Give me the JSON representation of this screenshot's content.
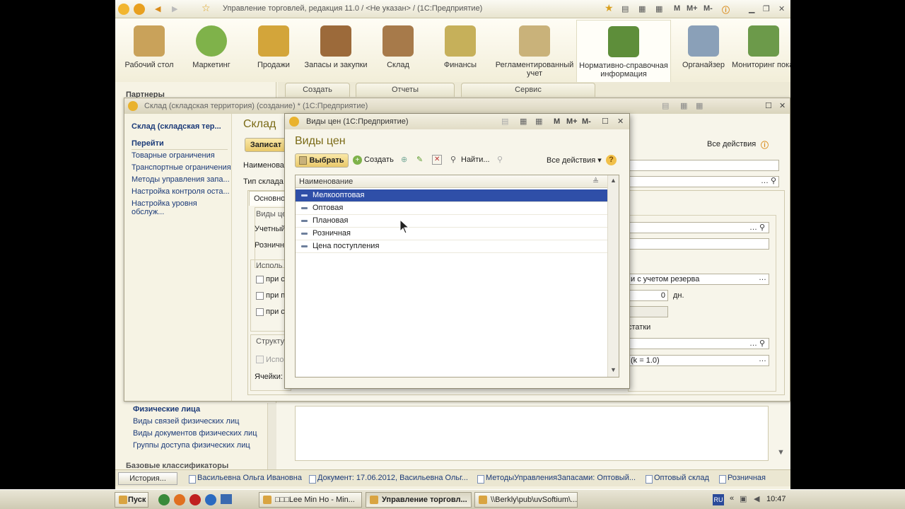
{
  "app": {
    "title": "Управление торговлей, редакция 11.0 / <Не указан> / (1С:Предприятие)",
    "title_buttons": [
      "M",
      "M+",
      "M-"
    ]
  },
  "sections": [
    {
      "label": "Рабочий стол",
      "icon": "desk-icon",
      "color": "#c9a25a"
    },
    {
      "label": "Маркетинг",
      "icon": "pie-chart-icon",
      "color": "#7fb24a"
    },
    {
      "label": "Продажи",
      "icon": "truck-icon",
      "color": "#d3a53a"
    },
    {
      "label": "Запасы и закупки",
      "icon": "boxes-icon",
      "color": "#9c6a3a"
    },
    {
      "label": "Склад",
      "icon": "warehouse-icon",
      "color": "#a77a4a"
    },
    {
      "label": "Финансы",
      "icon": "coins-icon",
      "color": "#c6b05a"
    },
    {
      "label": "Регламентированный учет",
      "icon": "ledger-icon",
      "color": "#c9b27a"
    },
    {
      "label": "Нормативно-справочная информация",
      "icon": "binders-icon",
      "color": "#5e8e3a"
    },
    {
      "label": "Органайзер",
      "icon": "clipboard-icon",
      "color": "#8aa0b8"
    },
    {
      "label": "Мониторинг показ",
      "icon": "monitor-icon",
      "color": "#6c9a4a"
    }
  ],
  "section_tabs": [
    "Создать",
    "Отчеты",
    "Сервис"
  ],
  "left_panel": {
    "top_header": "Партнеры",
    "header": "Физические лица",
    "items": [
      "Виды связей физических лиц",
      "Виды документов физических лиц",
      "Группы доступа физических лиц"
    ],
    "bottom_header": "Базовые классификаторы"
  },
  "sklad": {
    "title": "Склад (складская территория) (создание) * (1С:Предприятие)",
    "nav_title": "Склад (складская тер...",
    "nav_header": "Перейти",
    "nav_items": [
      "Товарные ограничения",
      "Транспортные ограничения",
      "Методы управления запа...",
      "Настройка контроля оста...",
      "Настройка уровня обслуж..."
    ],
    "heading": "Склад",
    "save_label": "Записат",
    "all_actions": "Все действия",
    "labels": {
      "name": "Наименова",
      "type": "Тип склада",
      "tab_main": "Основно",
      "group_prices": "Виды це",
      "accounting": "Учетный",
      "retail": "Розничн",
      "usage": "Исполь",
      "check1": "при с",
      "check2": "при п",
      "check3": "при с",
      "structure": "Структу",
      "use": "Испо",
      "cells": "Ячейки:",
      "reserve": "и с учетом резерва",
      "days_value": "0",
      "days": "дн.",
      "remains": "статки",
      "coef": "(k = 1.0)"
    }
  },
  "dialog": {
    "title": "Виды цен (1С:Предприятие)",
    "heading": "Виды цен",
    "toolbar": {
      "select": "Выбрать",
      "create": "Создать",
      "find": "Найти...",
      "all_actions": "Все действия"
    },
    "column": "Наименование",
    "rows": [
      "Мелкооптовая",
      "Оптовая",
      "Плановая",
      "Розничная",
      "Цена поступления"
    ],
    "selected_index": 0
  },
  "status_bar": {
    "history": "История...",
    "items": [
      "Васильевна Ольга Ивановна",
      "Документ: 17.06.2012, Васильевна Ольг...",
      "МетодыУправленияЗапасами: Оптовый...",
      "Оптовый склад",
      "Розничная"
    ]
  },
  "taskbar": {
    "start": "Пуск",
    "tasks": [
      "□□□Lee Min Ho - Min...",
      "Управление торговл...",
      "\\\\Berkly\\pub\\uvSoftium\\..."
    ],
    "lang": "RU",
    "clock": "10:47"
  }
}
